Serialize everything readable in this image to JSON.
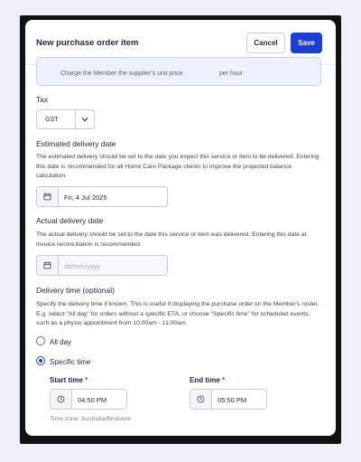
{
  "modal": {
    "title": "New purchase order item",
    "cancel_label": "Cancel",
    "save_label": "Save"
  },
  "info_box": {
    "left_text": "Charge the Member the supplier's unit price",
    "right_text": "per hour"
  },
  "tax": {
    "label": "Tax",
    "value": "GST"
  },
  "estimated_delivery": {
    "label": "Estimated delivery date",
    "help": "The estimated delivery should be set to the date you expect this service or item to be delivered. Entering this date is recommended for all Home Care Package clients to improve the projected balance calculation.",
    "value": "Fri, 4 Jul 2025"
  },
  "actual_delivery": {
    "label": "Actual delivery date",
    "help": "The actual delivery should be set to the date this service or item was delivered. Entering this date at invoice reconciliation is recommended.",
    "placeholder": "dd/mm/yyyy"
  },
  "delivery_time": {
    "label": "Delivery time (optional)",
    "help": "Specify the delivery time if known. This is useful if displaying the purchase order on the Member's roster. E.g. select \"All day\" for orders without a specific ETA, or choose \"Specific time\" for scheduled events, such as a physio appointment from 10:00am - 11:00am.",
    "options": [
      "All day",
      "Specific time"
    ],
    "selected": "Specific time",
    "start_label": "Start time",
    "start_value": "04:50 PM",
    "end_label": "End time",
    "end_value": "05:50 PM",
    "required_mark": "*",
    "timezone": "Time zone: Australia/Brisbane"
  },
  "colors": {
    "accent": "#1a3fd6",
    "required": "#d32f2f"
  }
}
